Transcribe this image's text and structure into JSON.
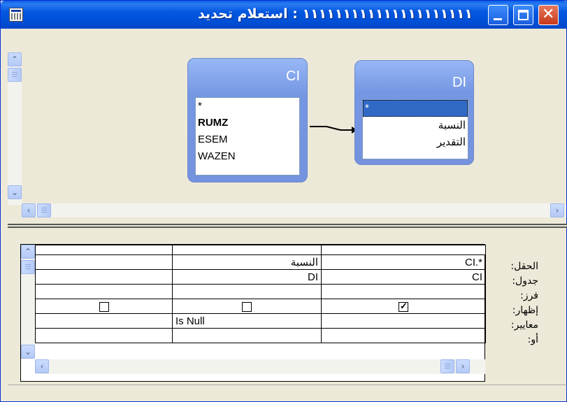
{
  "window": {
    "title": "١١١١١١١١١١١١١١١١١١١١١ : استعلام تحديد",
    "controls": {
      "minimize": "_",
      "maximize": "□",
      "close": "✕"
    },
    "icon": "query-grid-icon"
  },
  "tables": [
    {
      "name": "CI",
      "fields": [
        "*",
        "RUMZ",
        "ESEM",
        "WAZEN"
      ],
      "bold_field": "RUMZ"
    },
    {
      "name": "DI",
      "fields": [
        "*",
        "النسبة",
        "التقدير"
      ],
      "selected_field": "*"
    }
  ],
  "grid": {
    "row_labels": [
      "الحقل:",
      "جدول:",
      "فرز:",
      "إظهار:",
      "معايير:",
      "أو:"
    ],
    "columns": [
      {
        "field": "CI.*",
        "table": "CI",
        "sort": "",
        "show": true,
        "criteria": "",
        "or": ""
      },
      {
        "field": "النسبة",
        "table": "DI",
        "sort": "",
        "show": false,
        "criteria": "Is Null",
        "or": ""
      },
      {
        "field": "",
        "table": "",
        "sort": "",
        "show": false,
        "criteria": "",
        "or": ""
      }
    ]
  },
  "colors": {
    "title_bar": "#0051d8",
    "table_header": "#7597e3",
    "selection": "#316ac5",
    "close_button": "#c8381a"
  }
}
